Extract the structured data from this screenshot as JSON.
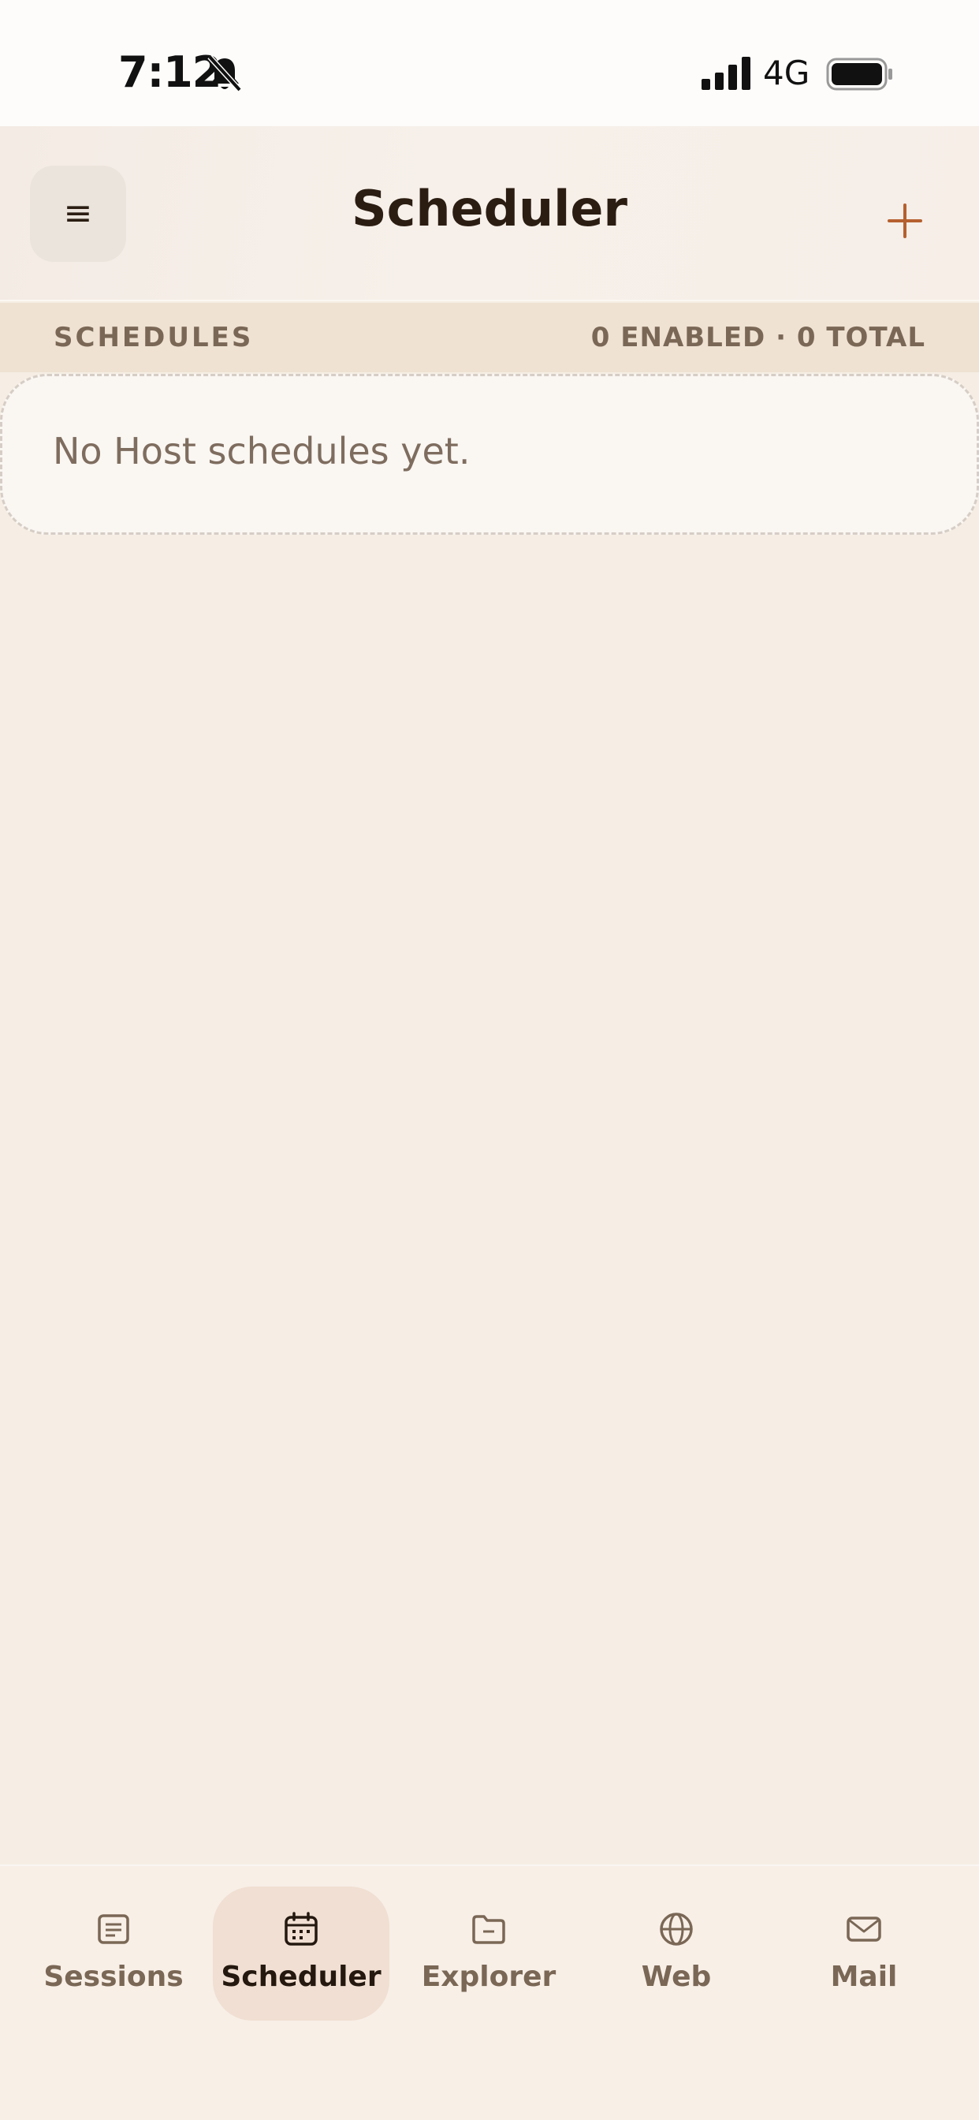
{
  "status_bar": {
    "time": "7:12",
    "network": "4G"
  },
  "header": {
    "title": "Scheduler",
    "menu_glyph": "≡",
    "add_glyph": "+"
  },
  "section": {
    "title": "SCHEDULES",
    "counts": "0 ENABLED · 0 TOTAL"
  },
  "empty_state": {
    "message": "No Host schedules yet."
  },
  "bottom_nav": {
    "items": [
      {
        "label": "Sessions",
        "icon": "list-icon",
        "active": false
      },
      {
        "label": "Scheduler",
        "icon": "calendar-icon",
        "active": true
      },
      {
        "label": "Explorer",
        "icon": "folder-icon",
        "active": false
      },
      {
        "label": "Web",
        "icon": "globe-icon",
        "active": false
      },
      {
        "label": "Mail",
        "icon": "mail-icon",
        "active": false
      }
    ]
  },
  "colors": {
    "accent": "#b5602f",
    "background": "#f6eee4",
    "text_dark": "#2b1d12",
    "text_muted": "#7a6755"
  }
}
